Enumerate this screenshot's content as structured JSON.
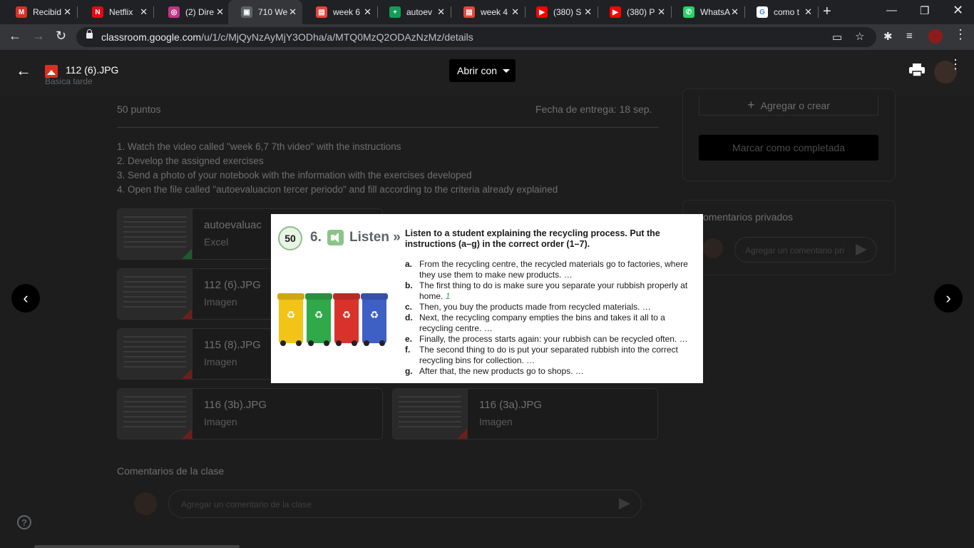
{
  "browser": {
    "tabs": [
      {
        "title": "Recibid",
        "favicon": "gmail-icon",
        "color": "#d93025",
        "glyph": "M"
      },
      {
        "title": "Netflix",
        "favicon": "netflix-icon",
        "color": "#e50914",
        "glyph": "N"
      },
      {
        "title": "(2) Dire",
        "favicon": "instagram-icon",
        "color": "#c13584",
        "glyph": "◎"
      },
      {
        "title": "710 We",
        "favicon": "image-icon",
        "color": "#5f6368",
        "glyph": "▣"
      },
      {
        "title": "week 6",
        "favicon": "video-icon",
        "color": "#e8453c",
        "glyph": "▤"
      },
      {
        "title": "autoev",
        "favicon": "sheets-icon",
        "color": "#0f9d58",
        "glyph": "+"
      },
      {
        "title": "week 4",
        "favicon": "video-icon",
        "color": "#e8453c",
        "glyph": "▤"
      },
      {
        "title": "(380) S",
        "favicon": "youtube-icon",
        "color": "#ff0000",
        "glyph": "▶"
      },
      {
        "title": "(380) P",
        "favicon": "youtube-icon",
        "color": "#ff0000",
        "glyph": "▶"
      },
      {
        "title": "WhatsA",
        "favicon": "whatsapp-icon",
        "color": "#25d366",
        "glyph": "✆"
      },
      {
        "title": "como t",
        "favicon": "google-icon",
        "color": "#ffffff",
        "glyph": "G"
      }
    ],
    "url_domain": "classroom.google.com",
    "url_path": "/u/1/c/MjQyNzAyMjY3ODha/a/MTQ0MzQ2ODAzNzMz/details"
  },
  "viewer": {
    "filename": "112 (6).JPG",
    "subtitle": "Basica tarde",
    "open_with": "Abrir con"
  },
  "assignment": {
    "points": "50 puntos",
    "due": "Fecha de entrega: 18 sep.",
    "instructions": [
      "1. Watch the video called \"week 6,7 7th video\" with the instructions",
      "2. Develop the assigned exercises",
      "3. Send a photo of your notebook with the information with the exercises developed",
      "4. Open the file called \"autoevaluacion tercer periodo\" and fill according to the criteria already explained"
    ],
    "attachments": [
      {
        "name": "autoevaluac",
        "type": "Excel"
      },
      {
        "name": "112 (6).JPG",
        "type": "Imagen"
      },
      {
        "name": "115 (8).JPG",
        "type": "Imagen"
      },
      {
        "name": "116 (3b).JPG",
        "type": "Imagen"
      },
      {
        "name": "116 (3a).JPG",
        "type": "Imagen"
      }
    ],
    "add_or_create": "Agregar o crear",
    "mark_done": "Marcar como completada",
    "private_comments": "omentarios privados",
    "private_placeholder": "Agregar un comentario pri",
    "class_comments": "Comentarios de la clase",
    "class_placeholder": "Agregar un comentario de la clase"
  },
  "image": {
    "page_number": "50",
    "exercise_number": "6.",
    "section": "Listen",
    "prompt": "Listen to a student explaining the recycling process. Put the instructions (a–g) in the correct order (1–7).",
    "items": [
      {
        "letter": "a.",
        "text": "From the recycling centre, the recycled materials go to factories, where they use them to make new products. …",
        "answer": ""
      },
      {
        "letter": "b.",
        "text": "The first thing to do is make sure you separate your rubbish properly at home.",
        "answer": "1"
      },
      {
        "letter": "c.",
        "text": "Then, you buy the products made from recycled materials. …",
        "answer": ""
      },
      {
        "letter": "d.",
        "text": "Next, the recycling company empties the bins and takes it all to a recycling centre. …",
        "answer": ""
      },
      {
        "letter": "e.",
        "text": "Finally, the process starts again: your rubbish can be recycled often. …",
        "answer": ""
      },
      {
        "letter": "f.",
        "text": "The second thing to do is put your separated rubbish into the correct recycling bins for collection. …",
        "answer": ""
      },
      {
        "letter": "g.",
        "text": "After that, the new products go to shops. …",
        "answer": ""
      }
    ],
    "bin_colors": [
      "#f2c418",
      "#2fa94a",
      "#d9322b",
      "#3e5fc4"
    ]
  }
}
